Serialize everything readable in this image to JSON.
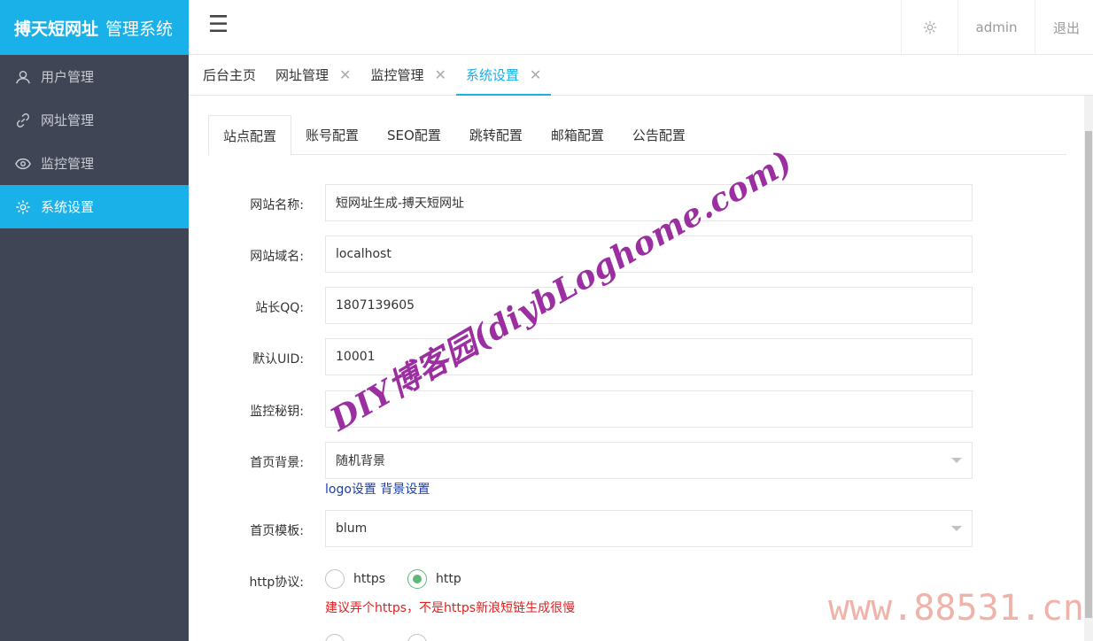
{
  "app": {
    "logo_brand": "搏天短网址",
    "logo_suffix": "管理系统"
  },
  "sidebar": {
    "items": [
      {
        "label": "用户管理",
        "icon": "user-icon",
        "active": false
      },
      {
        "label": "网址管理",
        "icon": "link-icon",
        "active": false
      },
      {
        "label": "监控管理",
        "icon": "eye-icon",
        "active": false
      },
      {
        "label": "系统设置",
        "icon": "gear-icon",
        "active": true
      }
    ]
  },
  "header": {
    "menu_icon": "☰",
    "user": "admin",
    "logout": "退出"
  },
  "page_tabs": [
    {
      "label": "后台主页",
      "closable": false
    },
    {
      "label": "网址管理",
      "closable": true
    },
    {
      "label": "监控管理",
      "closable": true
    },
    {
      "label": "系统设置",
      "closable": true,
      "active": true
    }
  ],
  "close_glyph": "✕",
  "sub_tabs": [
    "站点配置",
    "账号配置",
    "SEO配置",
    "跳转配置",
    "邮箱配置",
    "公告配置"
  ],
  "form": {
    "site_name": {
      "label": "网站名称:",
      "value": "短网址生成-搏天短网址"
    },
    "site_domain": {
      "label": "网站域名:",
      "value": "localhost"
    },
    "admin_qq": {
      "label": "站长QQ:",
      "value": "1807139605"
    },
    "default_uid": {
      "label": "默认UID:",
      "value": "10001"
    },
    "monitor_key": {
      "label": "监控秘钥:",
      "value": ""
    },
    "home_bg": {
      "label": "首页背景:",
      "value": "随机背景"
    },
    "logo_link": "logo设置",
    "bg_link": "背景设置",
    "home_template": {
      "label": "首页模板:",
      "value": "blum"
    },
    "http_protocol": {
      "label": "http协议:",
      "options": [
        "https",
        "http"
      ],
      "selected": "http"
    },
    "http_hint": "建议弄个https，不是https新浪短链生成很慢"
  },
  "watermarks": {
    "diagonal": "DIY博客园(diybLoghome.com)",
    "url": "www.88531.cn"
  },
  "colors": {
    "accent": "#1ab0e8",
    "sidebar_bg": "#3f4555",
    "radio_checked": "#5fb878",
    "hint_red": "#dd2222",
    "link_blue": "#1a3dae"
  }
}
